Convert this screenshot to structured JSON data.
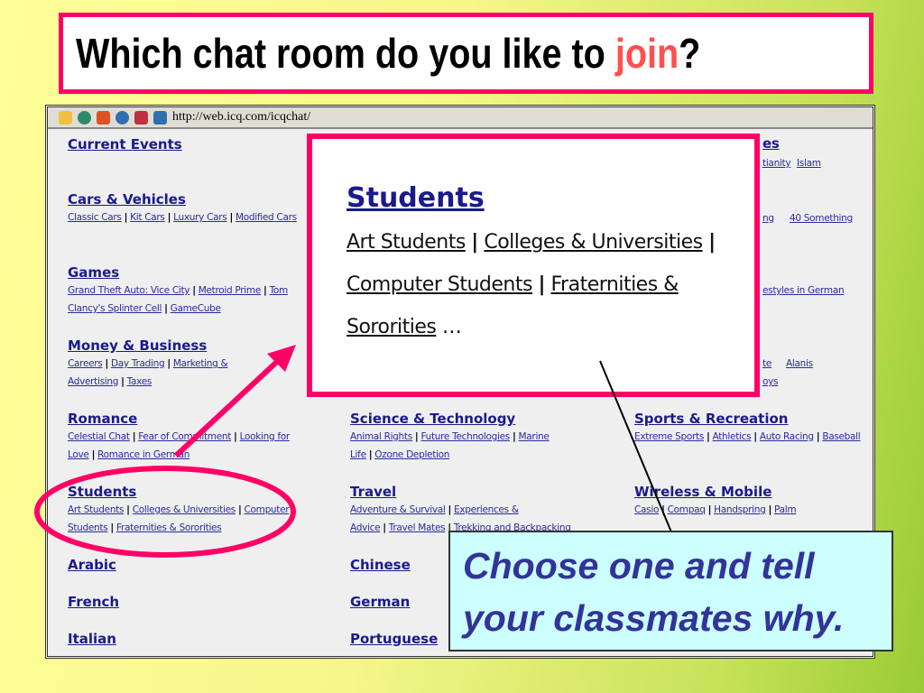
{
  "title": {
    "prefix": "Which chat room  do you like to ",
    "highlight": "join",
    "suffix": "?"
  },
  "browser": {
    "url": "http://web.icq.com/icqchat/",
    "toolbar_icons": [
      "folder-icon",
      "search-icon",
      "chart-icon",
      "globe-icon",
      "page-icon",
      "page-globe-icon"
    ]
  },
  "categories": {
    "current_events": {
      "title": "Current Events"
    },
    "cars": {
      "title": "Cars & Vehicles",
      "links": [
        "Classic Cars",
        "Kit Cars",
        "Luxury Cars",
        "Modified Cars"
      ]
    },
    "games": {
      "title": "Games",
      "links": [
        "Grand Theft Auto: Vice City",
        "Metroid Prime",
        "Tom Clancy's Splinter Cell",
        "GameCube"
      ]
    },
    "money": {
      "title": "Money & Business",
      "links": [
        "Careers",
        "Day Trading",
        "Marketing & Advertising",
        "Taxes"
      ]
    },
    "romance": {
      "title": "Romance",
      "links": [
        "Celestial Chat",
        "Fear of Commitment",
        "Looking for Love",
        "Romance in German"
      ]
    },
    "students": {
      "title": "Students",
      "links": [
        "Art Students",
        "Colleges & Universities",
        "Computer Students",
        "Fraternities & Sororities"
      ]
    },
    "arabic": {
      "title": "Arabic"
    },
    "french": {
      "title": "French"
    },
    "italian": {
      "title": "Italian"
    },
    "science": {
      "title": "Science & Technology",
      "links": [
        "Animal Rights",
        "Future Technologies",
        "Marine Life",
        "Ozone Depletion"
      ]
    },
    "travel": {
      "title": "Travel",
      "links": [
        "Adventure & Survival",
        "Experiences & Advice",
        "Travel Mates",
        "Trekking and Backpacking"
      ]
    },
    "chinese": {
      "title": "Chinese"
    },
    "german": {
      "title": "German"
    },
    "portuguese": {
      "title": "Portuguese"
    },
    "sports": {
      "title": "Sports & Recreation",
      "links": [
        "Extreme Sports",
        "Athletics",
        "Auto Racing",
        "Baseball"
      ]
    },
    "wireless": {
      "title": "Wireless & Mobile",
      "links": [
        "Casio",
        "Compaq",
        "Handspring",
        "Palm"
      ]
    }
  },
  "partial_fragments": [
    "es",
    "tianity",
    "Islam",
    "ng",
    "40 Something",
    "estyles in German",
    "te",
    "Alanis",
    "oys"
  ],
  "zoom_box": {
    "title": "Students",
    "links": [
      "Art Students",
      "Colleges & Universities",
      "Computer Students",
      "Fraternities & Sororities"
    ],
    "ellipsis": "…"
  },
  "callout": {
    "line1": "Choose one and tell",
    "line2": "your classmates why."
  },
  "colors": {
    "accent": "#ff0066",
    "link": "#1a1a8c",
    "callout_bg": "#ccffff",
    "callout_text": "#333399"
  }
}
